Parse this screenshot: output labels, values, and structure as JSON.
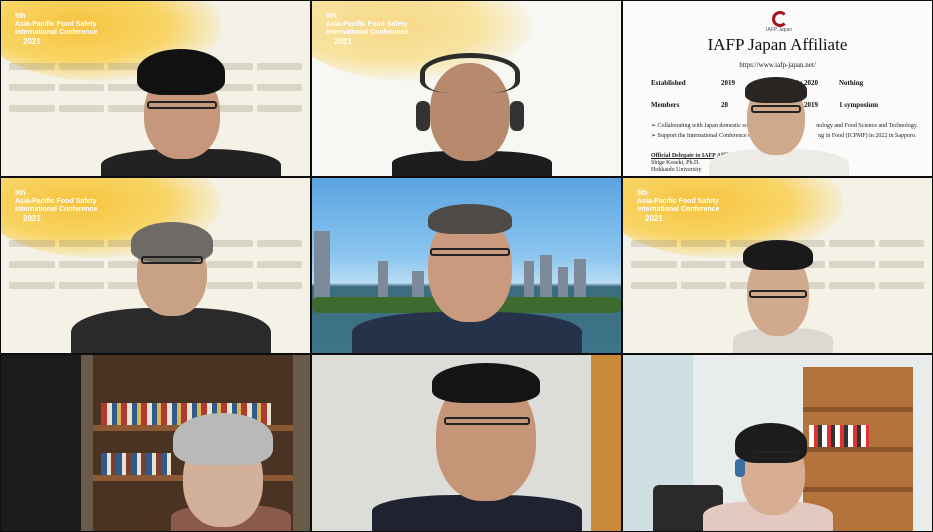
{
  "conference": {
    "title": "5th\nAsia-Pacific Food Safety\nInternational Conference",
    "year": "2021"
  },
  "slide": {
    "logo_text": "IAFP Japan",
    "title": "IAFP Japan Affiliate",
    "url": "https://www.iafp-japan.net/",
    "rows": [
      {
        "label": "Established",
        "value": "2019",
        "label2": "Activity in 2020",
        "value2": "Nothing"
      },
      {
        "label": "Members",
        "value": "28",
        "label2": "Activity in 2019",
        "value2": "1 symposium"
      }
    ],
    "bullets": [
      "➢ Collaborating with Japan domestic soci",
      "➢ Support the International Conference on"
    ],
    "bullets_tail": [
      "nology and Food Science and Technology.",
      "ng in Food (ICPMF) in 2022 in Sapporo."
    ],
    "delegate_label": "Official Delegate to IAFP Affiliate C",
    "delegate_name": "Shige Koseki, Ph.D.",
    "delegate_org": "Hokkaido University"
  },
  "colors": {
    "conference_yellow": "#f6c33e",
    "slide_red": "#a3171c"
  }
}
